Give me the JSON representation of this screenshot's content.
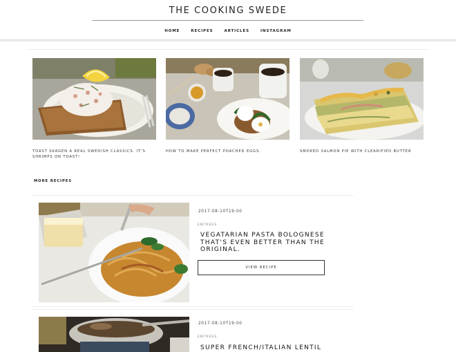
{
  "site": {
    "title": "THE COOKING SWEDE"
  },
  "nav": {
    "items": [
      {
        "label": "HOME"
      },
      {
        "label": "RECIPES"
      },
      {
        "label": "ARTICLES"
      },
      {
        "label": "INSTAGRAM"
      }
    ]
  },
  "featured": [
    {
      "caption": "TOAST SKAGEN A REAL SWEDISH CLASSICS. IT'S SHRIMPS ON TOAST!"
    },
    {
      "caption": "HOW TO MAKE PERFECT POACHED EGGS."
    },
    {
      "caption": "SMOKED SALMON PIE WITH CLEARIFIED BUTTER"
    }
  ],
  "more_recipes": {
    "heading": "MORE RECIPES",
    "items": [
      {
        "date": "2017-08-10T19:00",
        "category": "ENTREES",
        "title": "VEGATARIAN PASTA BOLOGNESE THAT'S EVEN BETTER THAN THE ORIGINAL.",
        "button_label": "VIEW RECIPE"
      },
      {
        "date": "2017-08-10T19:00",
        "category": "ENTREES",
        "title": "SUPER FRENCH/ITALIAN LENTIL"
      }
    ]
  }
}
